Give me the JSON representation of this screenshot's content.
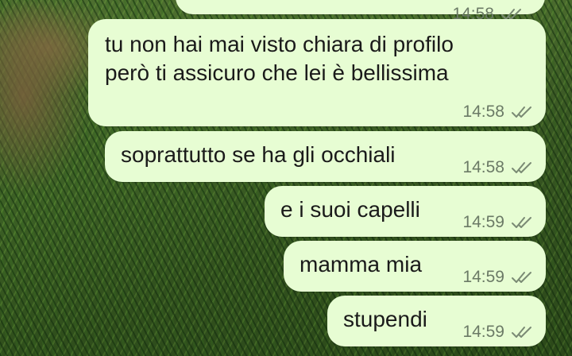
{
  "conversation": {
    "messages": [
      {
        "text_lines": [
          ""
        ],
        "time": "14:58",
        "status_icon": "double-check-icon"
      },
      {
        "text_lines": [
          "tu non hai mai visto chiara di profilo",
          "però ti assicuro che lei è bellissima"
        ],
        "time": "14:58",
        "status_icon": "double-check-icon"
      },
      {
        "text_lines": [
          "soprattutto se ha gli occhiali"
        ],
        "time": "14:58",
        "status_icon": "double-check-icon"
      },
      {
        "text_lines": [
          "e i suoi capelli"
        ],
        "time": "14:59",
        "status_icon": "double-check-icon"
      },
      {
        "text_lines": [
          "mamma mia"
        ],
        "time": "14:59",
        "status_icon": "double-check-icon"
      },
      {
        "text_lines": [
          "stupendi"
        ],
        "time": "14:59",
        "status_icon": "double-check-icon"
      }
    ]
  },
  "colors": {
    "bubble_background": "#e7fdd3",
    "message_text": "#1a1a1a",
    "meta_text": "#6b7a66"
  }
}
